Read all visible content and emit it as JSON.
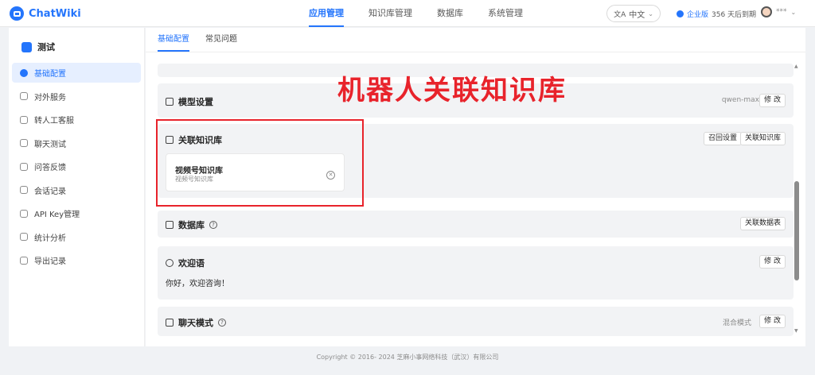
{
  "app": {
    "name": "ChatWiki"
  },
  "nav": {
    "items": [
      {
        "label": "应用管理",
        "active": true
      },
      {
        "label": "知识库管理",
        "active": false
      },
      {
        "label": "数据库",
        "active": false
      },
      {
        "label": "系统管理",
        "active": false
      }
    ]
  },
  "header": {
    "language": "中文",
    "edition_label": "企业版",
    "expiry": "356 天后到期",
    "username": "***"
  },
  "sidebar": {
    "robot_name": "测试",
    "items": [
      {
        "label": "基础配置",
        "active": true,
        "icon": "gear-icon"
      },
      {
        "label": "对外服务",
        "active": false,
        "icon": "service-icon"
      },
      {
        "label": "转人工客服",
        "active": false,
        "icon": "agent-icon"
      },
      {
        "label": "聊天测试",
        "active": false,
        "icon": "chat-test-icon"
      },
      {
        "label": "问答反馈",
        "active": false,
        "icon": "feedback-icon"
      },
      {
        "label": "会话记录",
        "active": false,
        "icon": "session-icon"
      },
      {
        "label": "API Key管理",
        "active": false,
        "icon": "key-icon"
      },
      {
        "label": "统计分析",
        "active": false,
        "icon": "stats-icon"
      },
      {
        "label": "导出记录",
        "active": false,
        "icon": "export-icon"
      }
    ]
  },
  "tabs": [
    {
      "label": "基础配置",
      "active": true
    },
    {
      "label": "常见问题",
      "active": false
    }
  ],
  "sections": {
    "model": {
      "title": "模型设置",
      "value": "qwen-max",
      "edit_label": "修 改"
    },
    "knowledge": {
      "title": "关联知识库",
      "recall_label": "召回设置",
      "link_label": "关联知识库",
      "card": {
        "title": "视频号知识库",
        "subtitle": "视频号知识库"
      }
    },
    "database": {
      "title": "数据库",
      "link_label": "关联数据表"
    },
    "welcome": {
      "title": "欢迎语",
      "edit_label": "修 改",
      "text": "你好，欢迎咨询！"
    },
    "chat_mode": {
      "title": "聊天模式",
      "value": "混合模式",
      "edit_label": "修 改"
    }
  },
  "annotation": "机器人关联知识库",
  "footer": "Copyright © 2016- 2024 芝麻小事网络科技（武汉）有限公司",
  "colors": {
    "accent": "#2475fc",
    "annotation": "#e8232b",
    "section_bg": "#f2f3f5"
  }
}
